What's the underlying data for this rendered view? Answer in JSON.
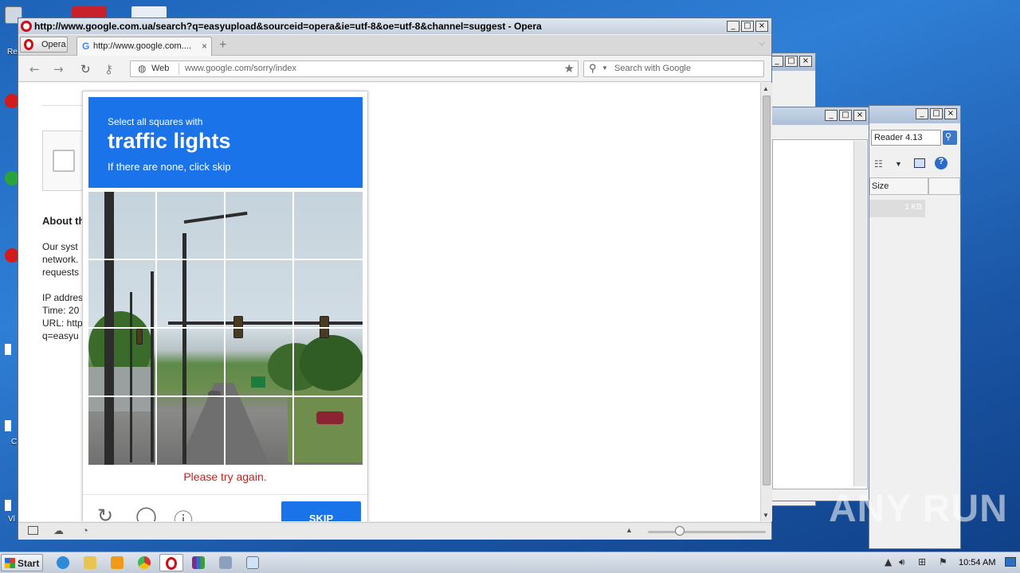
{
  "desktop": {
    "icon_label_re": "Re",
    "icon_label_c": "C",
    "icon_label_vl": "Vl"
  },
  "bg_window_3": {
    "search_value": "Reader 4.13",
    "column_header_size": "Size",
    "file_size": "1 KB"
  },
  "opera": {
    "title": "http://www.google.com.ua/search?q=easyupload&sourceid=opera&ie=utf-8&oe=utf-8&channel=suggest - Opera",
    "menu_button_label": "Opera",
    "tab_label": "http://www.google.com....",
    "web_label": "Web",
    "url": "www.google.com/sorry/index",
    "search_placeholder": "Search with Google"
  },
  "sorry_page": {
    "heading": "About th",
    "para1_line1": "Our syst",
    "para1_line2": "network.",
    "para1_line3": "requests",
    "ip_label": "IP addres",
    "time_label": "Time: 20",
    "url_label": "URL: http",
    "query_fragment": "q=easyu"
  },
  "captcha": {
    "instruction_line1": "Select all squares with",
    "target": "traffic lights",
    "instruction_line3": "If there are none, click skip",
    "error": "Please try again.",
    "skip_label": "SKIP"
  },
  "taskbar": {
    "start_label": "Start",
    "clock": "10:54 AM"
  },
  "watermark": "ANY RUN",
  "colors": {
    "captcha_blue": "#1a73e8",
    "error_red": "#c5221f",
    "opera_red": "#cc0f16"
  }
}
